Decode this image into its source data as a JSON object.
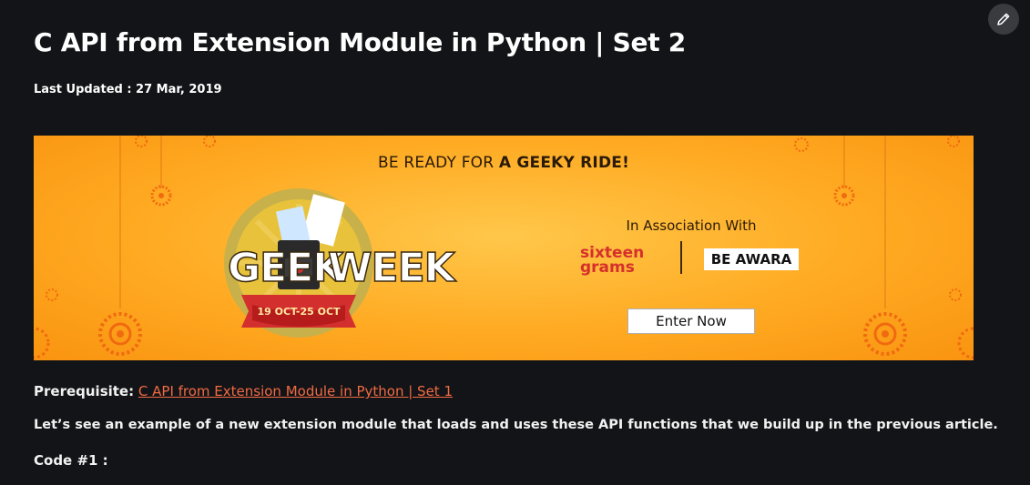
{
  "article": {
    "title": "C API from Extension Module in Python | Set 2",
    "last_updated": "Last Updated : 27 Mar, 2019"
  },
  "toolbar": {
    "edit_icon": "pencil-icon"
  },
  "banner": {
    "tagline_prefix": "BE READY FOR ",
    "tagline_bold": "A GEEKY RIDE!",
    "logo_left_text": "GEEK",
    "logo_right_text": "WEEK",
    "logo_date": "19 OCT-25 OCT",
    "association_text": "In Association With",
    "sponsor_1_line1": "sixteen",
    "sponsor_1_line2": "grams",
    "sponsor_2": "BE AWARA",
    "cta_label": "Enter Now",
    "colors": {
      "background": "#ffaa22",
      "ribbon": "#d32f2f",
      "badge": "#c8b04a"
    }
  },
  "body": {
    "prereq_label": "Prerequisite:",
    "prereq_link": "C API from Extension Module in Python | Set 1",
    "intro": "Let’s see an example of a new extension module that loads and uses these API functions that we build up in the previous article.",
    "code_heading": "Code #1 :"
  }
}
